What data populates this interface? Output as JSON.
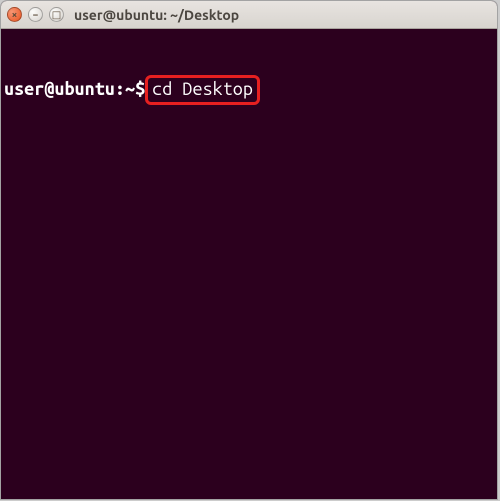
{
  "window": {
    "title": "user@ubuntu: ~/Desktop",
    "controls": {
      "close_glyph": "×",
      "minimize_glyph": "−",
      "maximize_glyph": "□"
    }
  },
  "terminal": {
    "prompt": {
      "user_host": "user@ubuntu",
      "separator": ":",
      "path": "~",
      "symbol": "$"
    },
    "command": "cd Desktop",
    "highlight_color": "#e62020"
  }
}
